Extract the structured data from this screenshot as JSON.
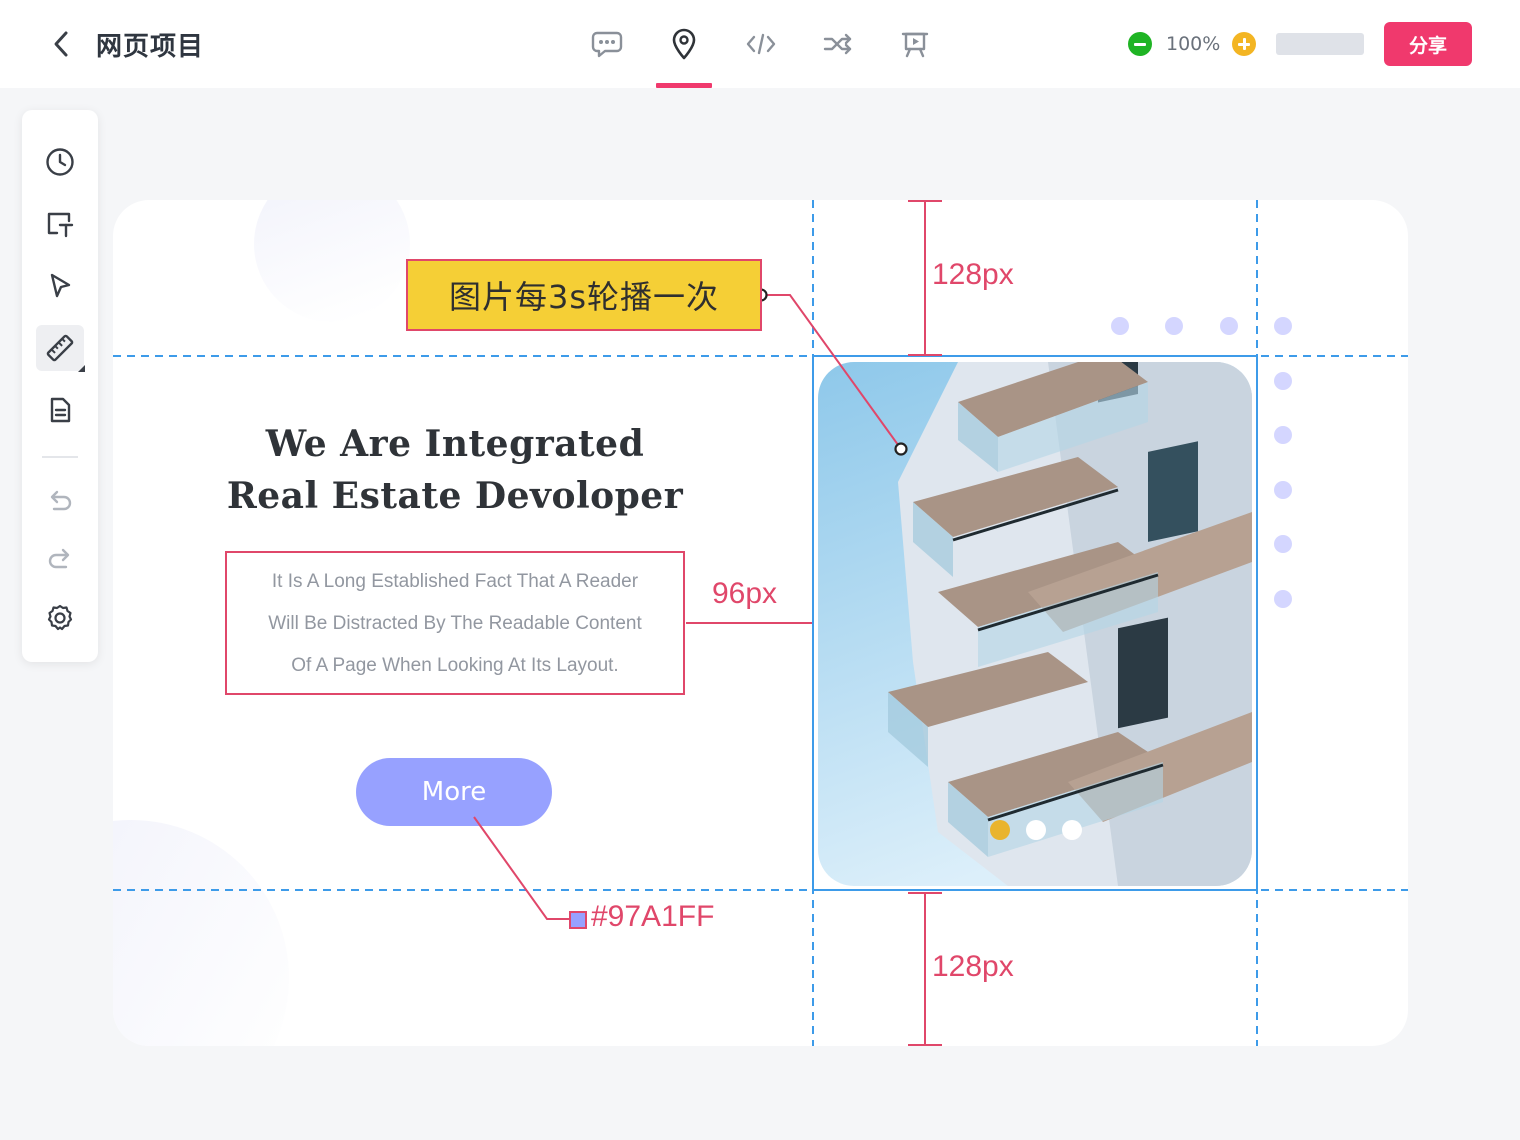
{
  "header": {
    "title": "网页项目",
    "zoom": "100%",
    "share_label": "分享",
    "tabs": [
      {
        "id": "comment",
        "icon": "chat-bubble-icon"
      },
      {
        "id": "annotate",
        "icon": "location-pin-icon",
        "active": true
      },
      {
        "id": "code",
        "icon": "code-icon"
      },
      {
        "id": "flow",
        "icon": "shuffle-icon"
      },
      {
        "id": "present",
        "icon": "presentation-icon"
      }
    ]
  },
  "toolbar": {
    "items": [
      {
        "id": "history",
        "icon": "clock-icon"
      },
      {
        "id": "text",
        "icon": "text-box-icon"
      },
      {
        "id": "select",
        "icon": "cursor-arrow-icon"
      },
      {
        "id": "measure",
        "icon": "ruler-icon",
        "active": true
      },
      {
        "id": "notes",
        "icon": "document-icon"
      },
      {
        "id": "undo",
        "icon": "undo-icon"
      },
      {
        "id": "redo",
        "icon": "redo-icon"
      },
      {
        "id": "settings",
        "icon": "gear-icon"
      }
    ]
  },
  "canvas": {
    "headline_line1": "We Are Integrated",
    "headline_line2": "Real Estate Devoloper",
    "body_line1": "It Is A Long Established Fact That A Reader",
    "body_line2": "Will Be Distracted By The Readable Content",
    "body_line3": "Of A Page When Looking At Its Layout.",
    "button_label": "More",
    "carousel": {
      "count": 3,
      "active_index": 0
    }
  },
  "annotations": {
    "note": "图片每3s轮播一次",
    "top_gap": "128px",
    "bottom_gap": "128px",
    "side_gap": "96px",
    "button_color": "#97A1FF"
  },
  "colors": {
    "accent": "#f0396d",
    "annotation": "#e0476a",
    "guide": "#3d9be9",
    "button": "#97a1ff",
    "note_bg": "#f5cf36",
    "carousel_active": "#e9b42e",
    "zoom_minus": "#1fb424",
    "zoom_plus": "#f3b523"
  }
}
